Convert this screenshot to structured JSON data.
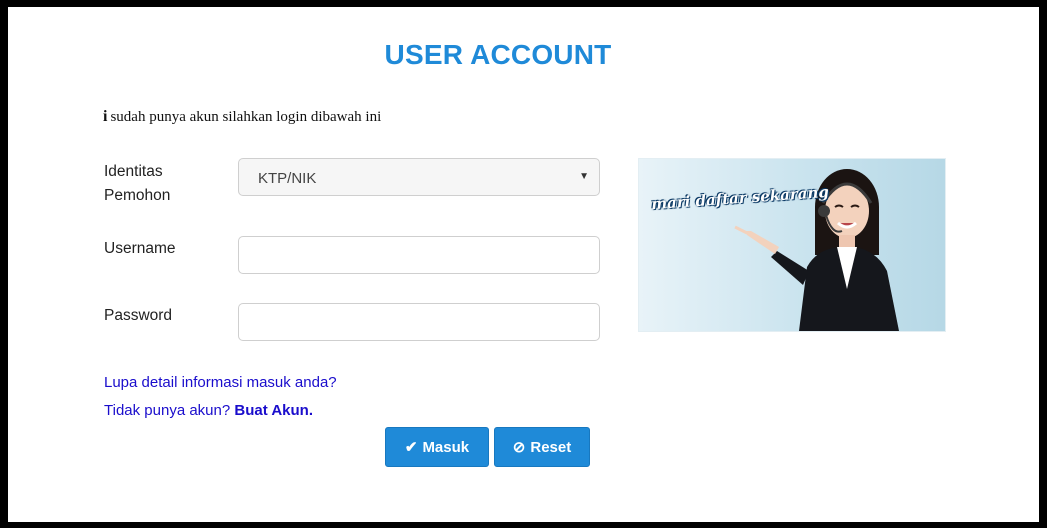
{
  "header": {
    "title": "USER ACCOUNT"
  },
  "info": {
    "icon": "info-icon",
    "text": "sudah punya akun silahkan login dibawah ini"
  },
  "form": {
    "identity_label_line1": "Identitas",
    "identity_label_line2": "Pemohon",
    "identity_value": "KTP/NIK",
    "username_label": "Username",
    "username_value": "",
    "password_label": "Password",
    "password_value": ""
  },
  "banner": {
    "text": "mari daftar sekarang"
  },
  "links": {
    "forgot": "Lupa detail informasi masuk anda?",
    "no_account": "Tidak punya akun?",
    "create_account": "Buat Akun."
  },
  "buttons": {
    "login": "Masuk",
    "reset": "Reset"
  },
  "colors": {
    "accent": "#1f8ad8",
    "link": "#1a0dcc"
  }
}
